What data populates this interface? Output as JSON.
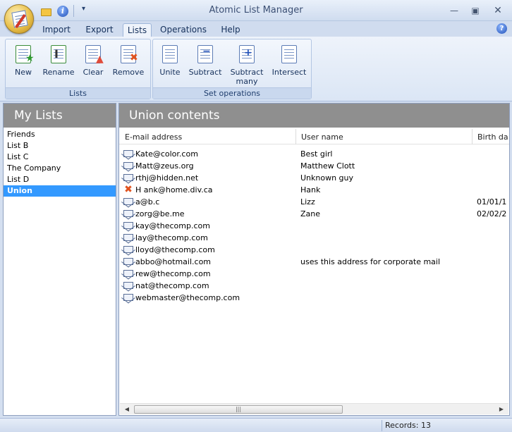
{
  "window": {
    "title": "Atomic List Manager"
  },
  "quick_access": {
    "folder_icon": "open-folder-icon",
    "info_icon": "info-icon",
    "more_label": "▾"
  },
  "menu": {
    "tabs": [
      "Import",
      "Export",
      "Lists",
      "Operations",
      "Help"
    ],
    "active_tab": "Lists"
  },
  "ribbon": {
    "groups": [
      {
        "label": "Lists",
        "buttons": [
          "New",
          "Rename",
          "Clear",
          "Remove"
        ]
      },
      {
        "label": "Set operations",
        "buttons": [
          "Unite",
          "Subtract",
          "Subtract many",
          "Intersect"
        ]
      }
    ],
    "subtract_many_line1": "Subtract",
    "subtract_many_line2": "many"
  },
  "left_panel": {
    "title": "My Lists",
    "items": [
      "Friends",
      "List B",
      "List C",
      "The Company",
      "List D",
      "Union"
    ],
    "selected": "Union"
  },
  "right_panel": {
    "title": "Union contents",
    "columns": [
      "E-mail address",
      "User name",
      "Birth da"
    ],
    "rows": [
      {
        "email": "Kate@color.com",
        "user": "Best girl",
        "birth": "",
        "icon": "mail-icon"
      },
      {
        "email": "Matt@zeus.org",
        "user": "Matthew Clott",
        "birth": "",
        "icon": "mail-icon"
      },
      {
        "email": "rthj@hidden.net",
        "user": "Unknown guy",
        "birth": "",
        "icon": "mail-icon"
      },
      {
        "email": "H ank@home.div.ca",
        "user": "Hank",
        "birth": "",
        "icon": "invalid-x-icon"
      },
      {
        "email": "a@b.c",
        "user": "Lizz",
        "birth": "01/01/1",
        "icon": "mail-icon"
      },
      {
        "email": "zorg@be.me",
        "user": "Zane",
        "birth": "02/02/2",
        "icon": "mail-icon"
      },
      {
        "email": "kay@thecomp.com",
        "user": "",
        "birth": "",
        "icon": "mail-icon"
      },
      {
        "email": "lay@thecomp.com",
        "user": "",
        "birth": "",
        "icon": "mail-icon"
      },
      {
        "email": "lloyd@thecomp.com",
        "user": "",
        "birth": "",
        "icon": "mail-icon"
      },
      {
        "email": "abbo@hotmail.com",
        "user": "uses this address for corporate mail",
        "birth": "",
        "icon": "mail-icon"
      },
      {
        "email": "rew@thecomp.com",
        "user": "",
        "birth": "",
        "icon": "mail-icon"
      },
      {
        "email": "nat@thecomp.com",
        "user": "",
        "birth": "",
        "icon": "mail-icon"
      },
      {
        "email": "webmaster@thecomp.com",
        "user": "",
        "birth": "",
        "icon": "mail-icon"
      }
    ]
  },
  "status": {
    "records": "Records: 13"
  }
}
